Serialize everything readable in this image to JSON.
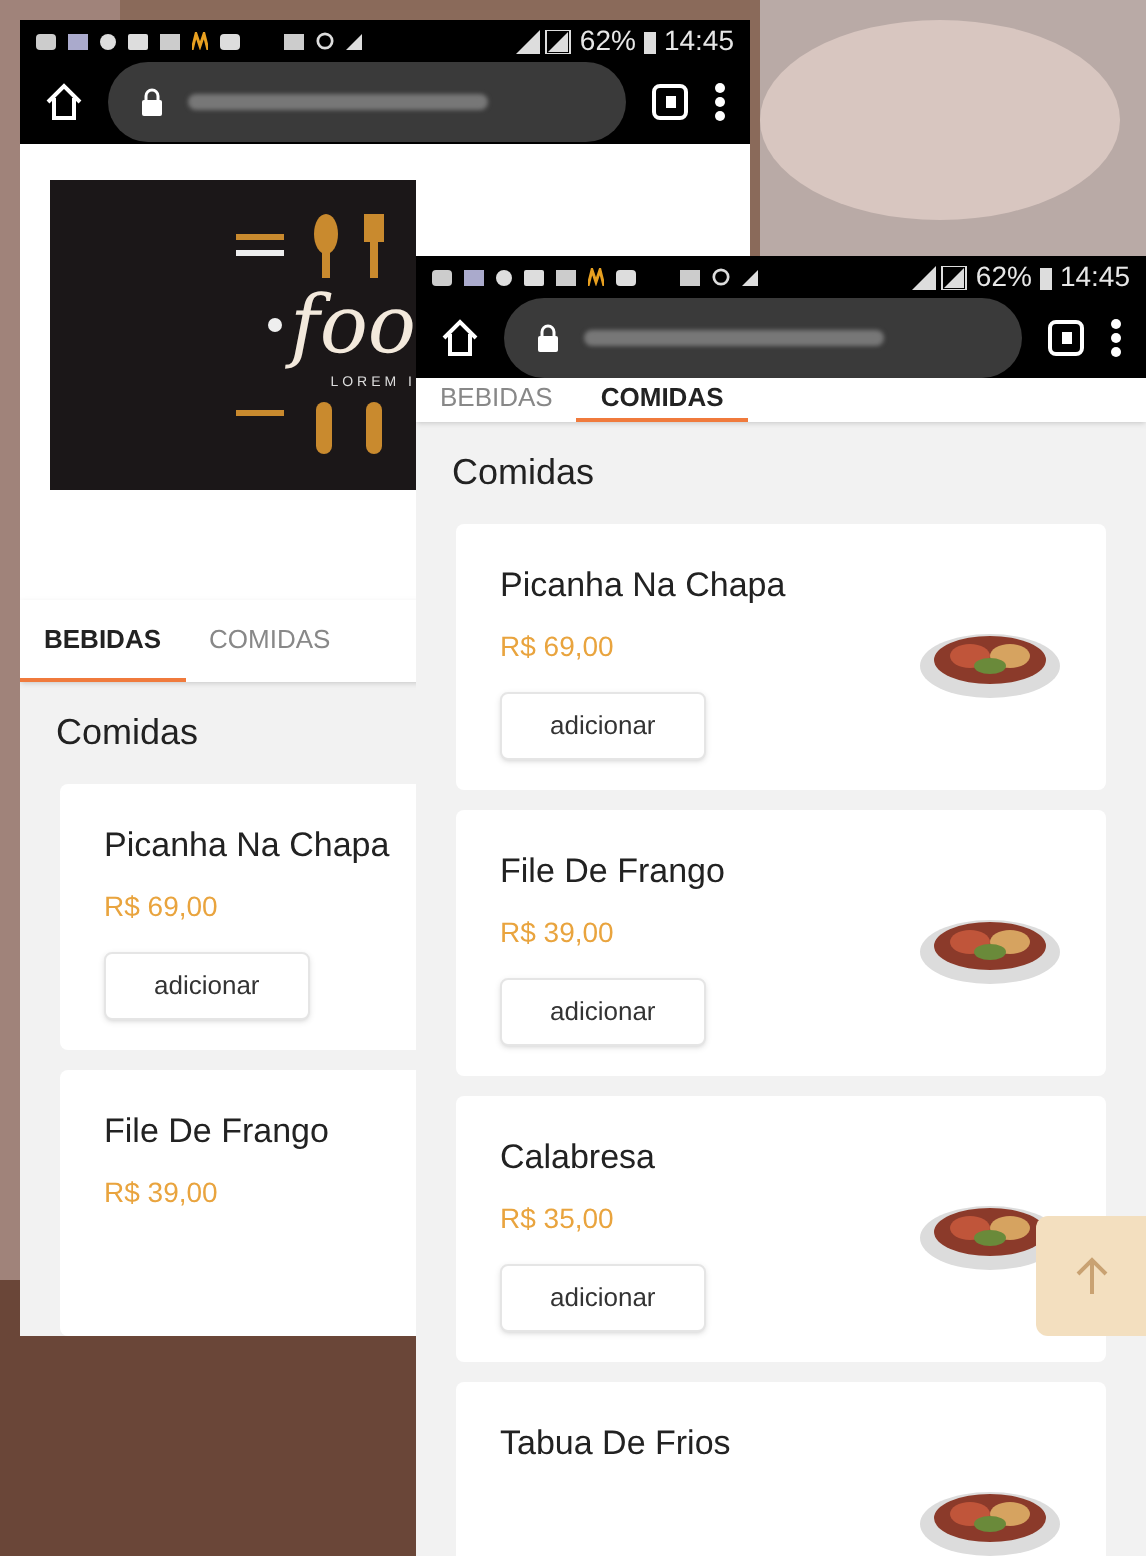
{
  "screens": [
    {
      "status_bar": {
        "battery": "62%",
        "time": "14:45"
      },
      "logo": {
        "text": "foo",
        "tagline": "LOREM I"
      },
      "tabs": [
        {
          "label": "BEBIDAS",
          "selected": true
        },
        {
          "label": "COMIDAS",
          "selected": false
        }
      ],
      "section_title": "Comidas",
      "items": [
        {
          "name": "Picanha Na Chapa",
          "price": "R$ 69,00",
          "button": "adicionar",
          "picture": false
        },
        {
          "name": "File De Frango",
          "price": "R$ 39,00",
          "picture": false
        }
      ]
    },
    {
      "status_bar": {
        "battery": "62%",
        "time": "14:45"
      },
      "tabs": [
        {
          "label": "BEBIDAS",
          "selected": false
        },
        {
          "label": "COMIDAS",
          "selected": true
        }
      ],
      "section_title": "Comidas",
      "items": [
        {
          "name": "Picanha Na Chapa",
          "price": "R$ 69,00",
          "button": "adicionar",
          "picture": true
        },
        {
          "name": "File De Frango",
          "price": "R$ 39,00",
          "button": "adicionar",
          "picture": true
        },
        {
          "name": "Calabresa",
          "price": "R$ 35,00",
          "button": "adicionar",
          "picture": true
        },
        {
          "name": "Tabua De Frios",
          "picture": true
        }
      ]
    }
  ]
}
